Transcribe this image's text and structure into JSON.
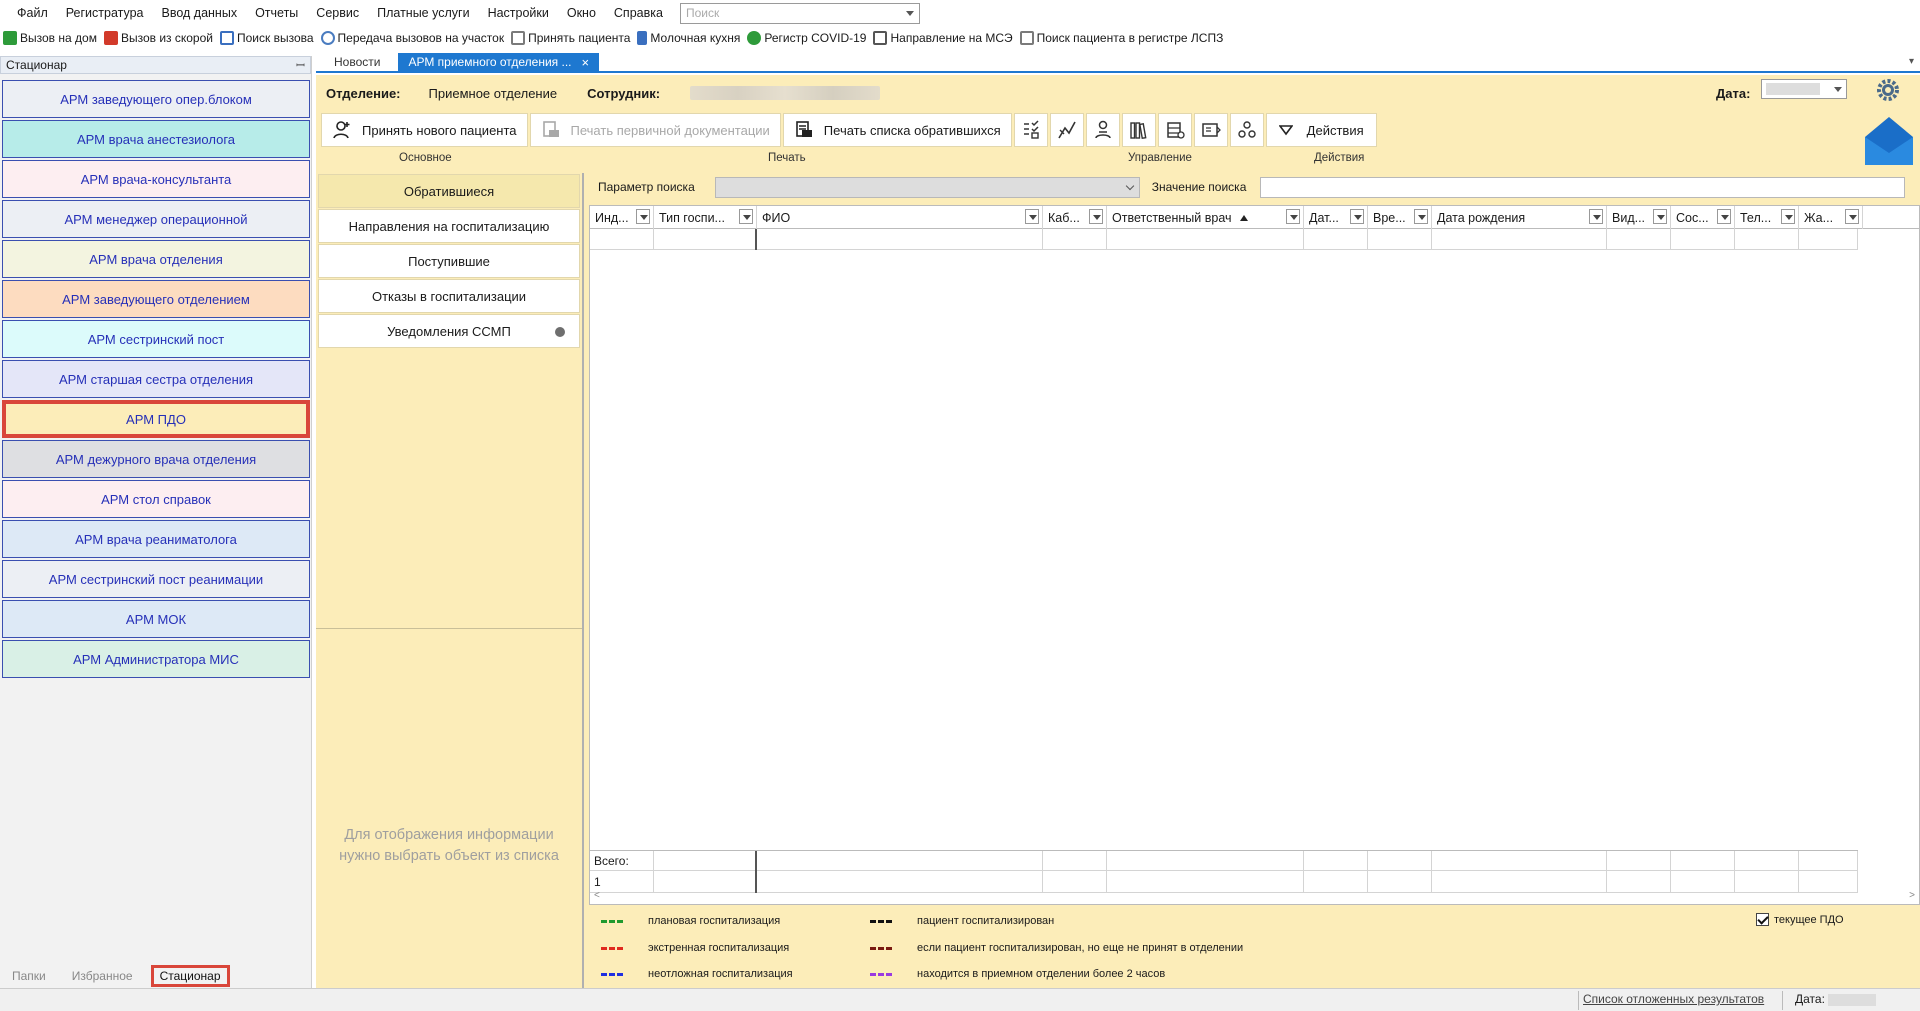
{
  "menu": {
    "items": [
      "Файл",
      "Регистратура",
      "Ввод данных",
      "Отчеты",
      "Сервис",
      "Платные услуги",
      "Настройки",
      "Окно",
      "Справка"
    ],
    "search_placeholder": "Поиск"
  },
  "quickbar": {
    "items": [
      {
        "label": "Вызов на дом",
        "icon": "check-green-icon",
        "color": "#2e9b3a"
      },
      {
        "label": "Вызов из скорой",
        "icon": "check-red-icon",
        "color": "#d23a2a"
      },
      {
        "label": "Поиск вызова",
        "icon": "search-doc-icon",
        "color": "#3a6fbf"
      },
      {
        "label": "Передача вызовов на участок",
        "icon": "transfer-icon",
        "color": "#4a7cc0"
      },
      {
        "label": "Принять пациента",
        "icon": "doc-icon",
        "color": "#7a7a7a"
      },
      {
        "label": "Молочная кухня",
        "icon": "bottle-icon",
        "color": "#3a6fbf"
      },
      {
        "label": "Регистр COVID-19",
        "icon": "virus-icon",
        "color": "#2e9b3a"
      },
      {
        "label": "Направление на МСЭ",
        "icon": "doc-arrow-icon",
        "color": "#555555"
      },
      {
        "label": "Поиск пациента в регистре ЛСПЗ",
        "icon": "doc-search-icon",
        "color": "#7a7a7a"
      }
    ]
  },
  "leftpanel": {
    "title": "Стационар",
    "pin": "ꟷ",
    "arms": [
      {
        "label": "АРМ заведующего опер.блоком",
        "bg": "#eceff4"
      },
      {
        "label": "АРМ врача анестезиолога",
        "bg": "#b7ece9"
      },
      {
        "label": "АРМ врача-консультанта",
        "bg": "#fdeef1"
      },
      {
        "label": "АРМ менеджер  операционной",
        "bg": "#eceff4"
      },
      {
        "label": "АРМ врача отделения",
        "bg": "#f3f4e0"
      },
      {
        "label": "АРМ заведующего отделением",
        "bg": "#fddcc0"
      },
      {
        "label": "АРМ сестринский пост",
        "bg": "#dcfbfb"
      },
      {
        "label": "АРМ старшая сестра отделения",
        "bg": "#e4e6f8"
      },
      {
        "label": "АРМ ПДО",
        "bg": "#fcedb9",
        "selected": true
      },
      {
        "label": "АРМ дежурного врача отделения",
        "bg": "#dedfe2"
      },
      {
        "label": "АРМ стол справок",
        "bg": "#fdeef1"
      },
      {
        "label": "АРМ врача реаниматолога",
        "bg": "#dde9f6"
      },
      {
        "label": "АРМ сестринский пост реанимации",
        "bg": "#eceff4"
      },
      {
        "label": "АРМ МОК",
        "bg": "#dde9f6"
      },
      {
        "label": "АРМ Администратора МИС",
        "bg": "#d9f0e6"
      }
    ],
    "tabs": [
      "Папки",
      "Избранное",
      "Стационар"
    ],
    "active_tab": "Стационар"
  },
  "doctabs": {
    "items": [
      "Новости",
      "АРМ приемного отделения ..."
    ],
    "active": "АРМ приемного отделения ...",
    "close": "×",
    "corner": "▾"
  },
  "infobar": {
    "dept_label": "Отделение:",
    "dept_value": "Приемное отделение",
    "employee_label": "Сотрудник:",
    "date_label": "Дата:"
  },
  "toolbar": {
    "new_patient": "Принять нового пациента",
    "print_primary": "Печать первичной документации",
    "print_list": "Печать списка обратившихся",
    "actions": "Действия",
    "icon_buttons": [
      "checklist-icon",
      "chart-pen-icon",
      "person-hand-icon",
      "books-icon",
      "cabinet-icon",
      "id-card-icon",
      "persons-icon"
    ],
    "groups": [
      "Основное",
      "Печать",
      "Управление",
      "Действия"
    ]
  },
  "subnav": {
    "items": [
      "Обратившиеся",
      "Направления на госпитализацию",
      "Поступившие",
      "Отказы в госпитализации",
      "Уведомления ССМП"
    ],
    "active": "Обратившиеся",
    "hint_line1": "Для отображения информации",
    "hint_line2": "нужно выбрать объект из списка"
  },
  "search": {
    "param_label": "Параметр поиска",
    "value_label": "Значение поиска"
  },
  "grid": {
    "columns": [
      "Инд...",
      "Тип госпи...",
      "ФИО",
      "Каб...",
      "Ответственный врач",
      "Дат...",
      "Вре...",
      "Дата рождения",
      "Вид...",
      "Сос...",
      "Тел...",
      "Жа..."
    ],
    "total_label": "Всего:",
    "total_value": "1",
    "scroll_left": "<",
    "scroll_right": ">"
  },
  "legend": {
    "items": [
      {
        "label": "плановая госпитализация",
        "color": "#1f9a2e"
      },
      {
        "label": "экстренная госпитализация",
        "color": "#e02a1f"
      },
      {
        "label": "неотложная госпитализация",
        "color": "#1f2fe0"
      },
      {
        "label": "пациент госпитализирован",
        "color": "#111111"
      },
      {
        "label": "если пациент госпитализирован, но еще не принят в  отделении",
        "color": "#7a1a10"
      },
      {
        "label": "находится в приемном отделении более 2 часов",
        "color": "#9a3ae0"
      }
    ],
    "checkbox_label": "текущее ПДО",
    "checkbox_checked": true
  },
  "status": {
    "deferred_link": "Список отложенных результатов",
    "date_label": "Дата:"
  }
}
